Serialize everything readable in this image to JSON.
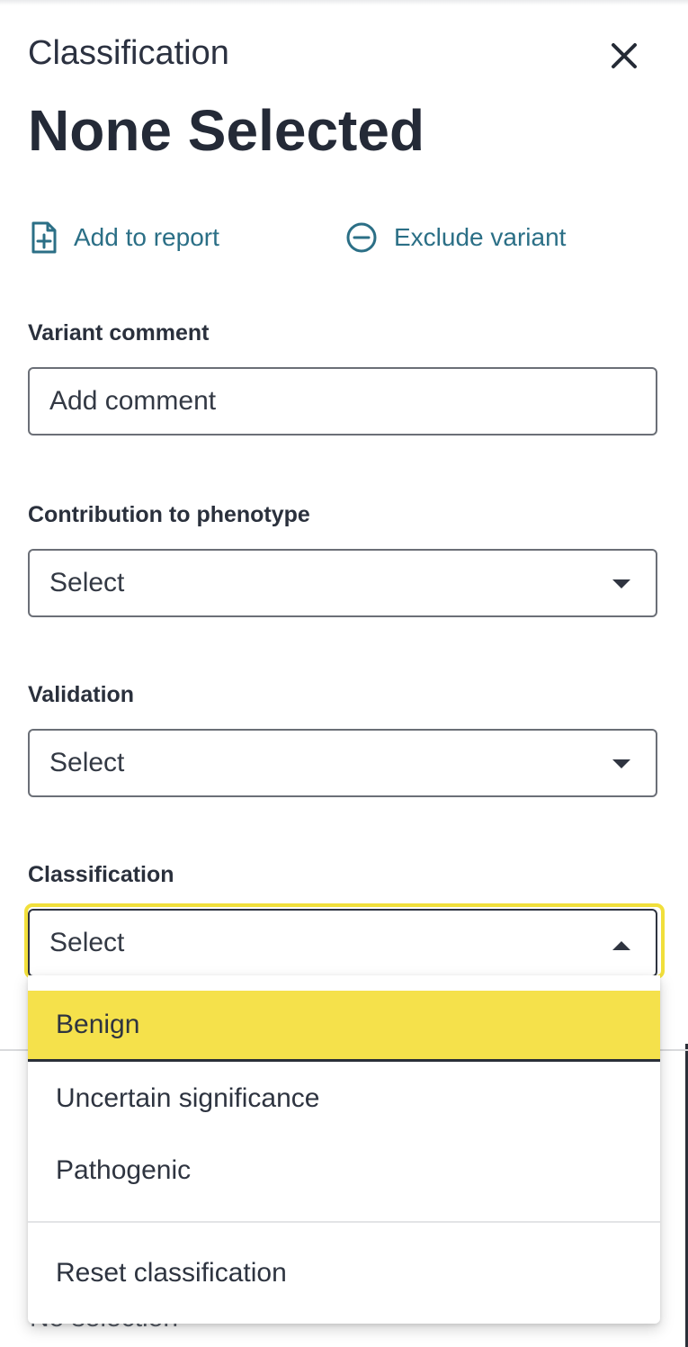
{
  "header": {
    "label": "Classification",
    "title": "None Selected",
    "close_icon": "close-icon"
  },
  "actions": {
    "add_to_report": {
      "label": "Add to report",
      "icon": "file-plus-icon"
    },
    "exclude_variant": {
      "label": "Exclude variant",
      "icon": "minus-circle-icon"
    }
  },
  "form": {
    "variant_comment": {
      "label": "Variant comment",
      "placeholder": "Add comment",
      "value": ""
    },
    "contribution": {
      "label": "Contribution to phenotype",
      "value": "Select"
    },
    "validation": {
      "label": "Validation",
      "value": "Select"
    },
    "classification": {
      "label": "Classification",
      "value": "Select",
      "expanded": true
    }
  },
  "dropdown": {
    "options": [
      "Benign",
      "Uncertain significance",
      "Pathogenic"
    ],
    "highlighted": "Benign",
    "reset_label": "Reset classification"
  },
  "background": {
    "partial_text": "No selection"
  },
  "colors": {
    "accent": "#2b6f86",
    "highlight": "#f5e14b",
    "focus_ring": "#f1df3b",
    "text": "#242a37"
  }
}
